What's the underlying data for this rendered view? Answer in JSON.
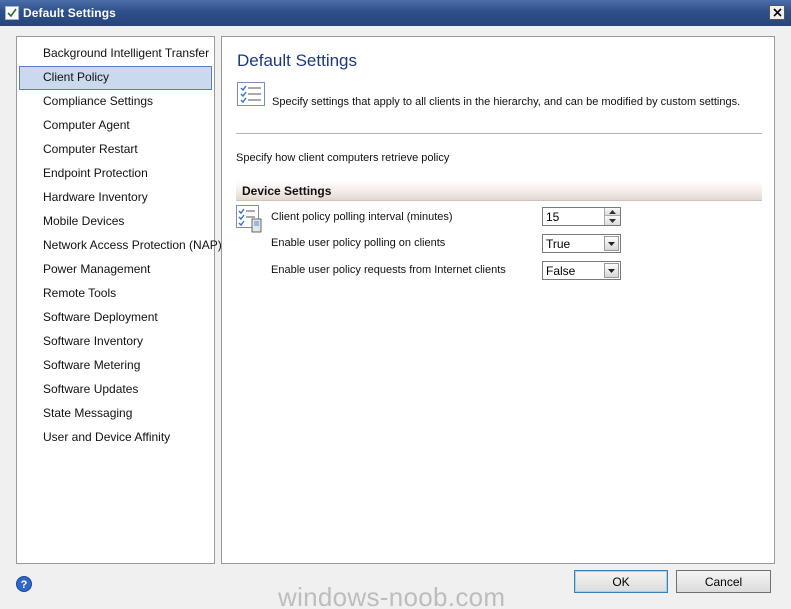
{
  "window": {
    "title": "Default Settings",
    "icon": "checklist-icon",
    "close": "close-icon"
  },
  "sidebar": {
    "items": [
      {
        "label": "Background Intelligent Transfer",
        "selected": false
      },
      {
        "label": "Client Policy",
        "selected": true
      },
      {
        "label": "Compliance Settings",
        "selected": false
      },
      {
        "label": "Computer Agent",
        "selected": false
      },
      {
        "label": "Computer Restart",
        "selected": false
      },
      {
        "label": "Endpoint Protection",
        "selected": false
      },
      {
        "label": "Hardware Inventory",
        "selected": false
      },
      {
        "label": "Mobile Devices",
        "selected": false
      },
      {
        "label": "Network Access Protection (NAP)",
        "selected": false
      },
      {
        "label": "Power Management",
        "selected": false
      },
      {
        "label": "Remote Tools",
        "selected": false
      },
      {
        "label": "Software Deployment",
        "selected": false
      },
      {
        "label": "Software Inventory",
        "selected": false
      },
      {
        "label": "Software Metering",
        "selected": false
      },
      {
        "label": "Software Updates",
        "selected": false
      },
      {
        "label": "State Messaging",
        "selected": false
      },
      {
        "label": "User and Device Affinity",
        "selected": false
      }
    ]
  },
  "main": {
    "title": "Default Settings",
    "description": "Specify settings that apply to all clients in the hierarchy, and can be modified by custom settings.",
    "subtitle": "Specify how client computers retrieve policy",
    "section": "Device Settings",
    "settings": [
      {
        "label": "Client policy polling interval (minutes)",
        "value": "15"
      },
      {
        "label": "Enable user policy polling on clients",
        "value": "True"
      },
      {
        "label": "Enable user policy requests from Internet clients",
        "value": "False"
      }
    ]
  },
  "footer": {
    "ok": "OK",
    "cancel": "Cancel",
    "help": "help-icon"
  },
  "watermark": "windows-noob.com",
  "colors": {
    "titlebar": "#2e4f8a",
    "selection": "#cbd9ee",
    "title_text": "#1c3a7a"
  }
}
